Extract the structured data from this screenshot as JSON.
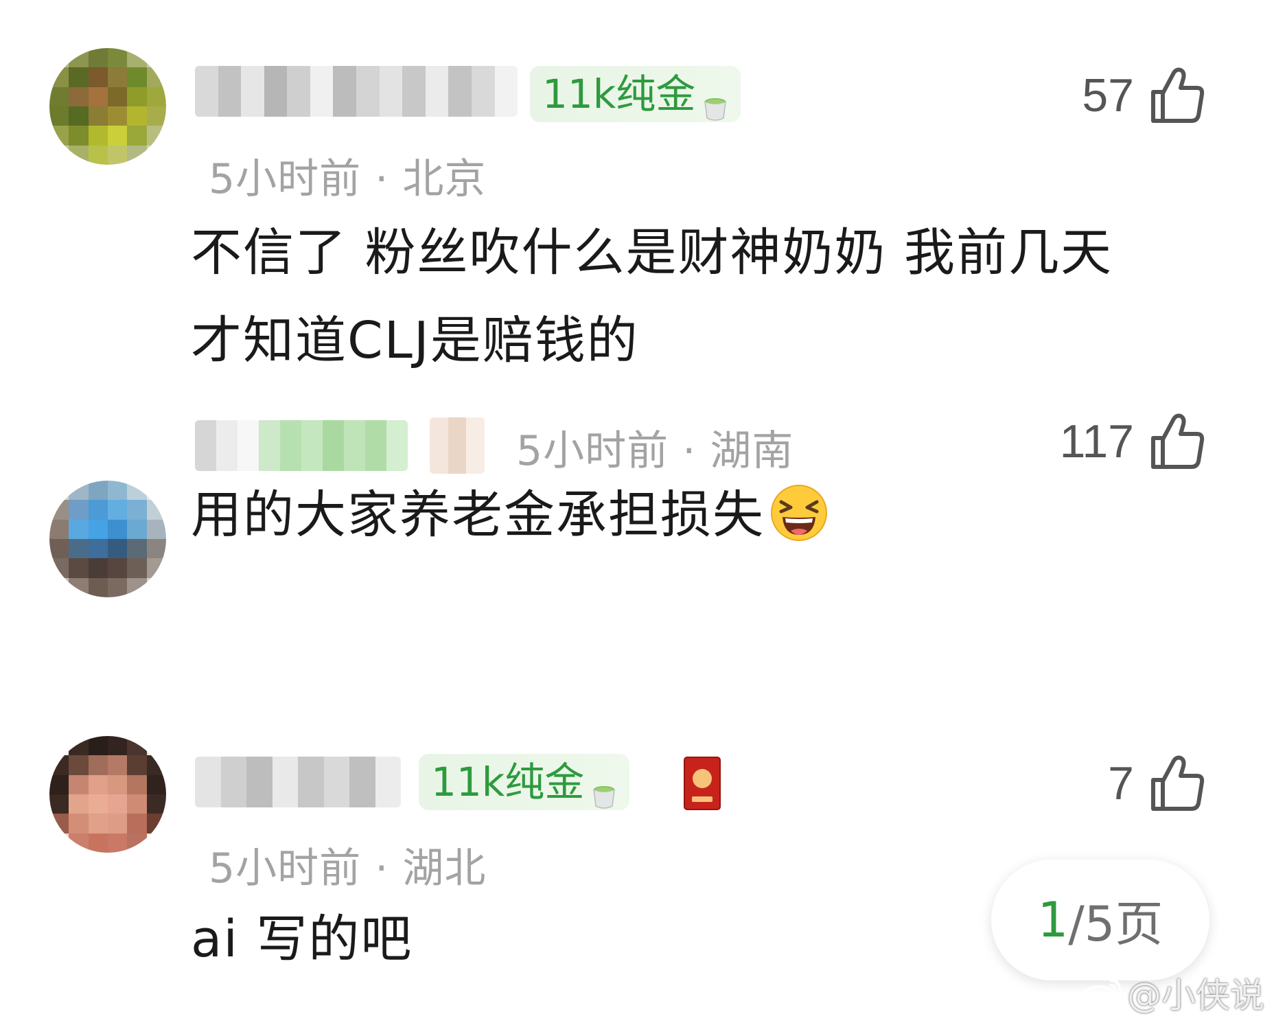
{
  "comments": [
    {
      "badge": "11k纯金",
      "meta": "5小时前 · 北京",
      "content_line1": "不信了 粉丝吹什么是财神奶奶 我前几天",
      "content_line2": "才知道CLJ是赔钱的",
      "likes": "57"
    },
    {
      "meta": "5小时前 · 湖南",
      "content": "用的大家养老金承担损失",
      "likes": "117"
    },
    {
      "badge": "11k纯金",
      "meta": "5小时前 · 湖北",
      "content": "ai 写的吧",
      "likes": "7"
    }
  ],
  "pager": {
    "current": "1",
    "total": "/5页"
  },
  "watermark": {
    "text": "@小侠说"
  },
  "colors": {
    "badge_green": "#2e9a3e",
    "meta_gray": "#a3a3a3",
    "like_gray": "#555555"
  },
  "icons": [
    "thumbs-up-icon",
    "teacup-icon",
    "laughing-emoji",
    "red-packet-icon",
    "weibo-icon"
  ]
}
